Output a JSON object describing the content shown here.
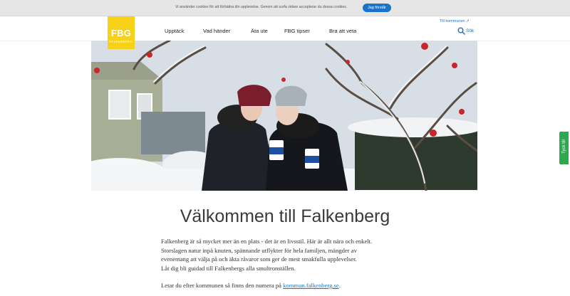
{
  "cookie": {
    "text": "Vi använder cookies för att förbättra din upplevelse. Genom att surfa vidare accepterar du dessa cookies.",
    "accept_label": "Jag förstår"
  },
  "header": {
    "logo_text": "FBG",
    "logo_subtext": "FALKENBERG",
    "top_link": "Till kommunen ↗",
    "search_label": "Sök",
    "nav": [
      "Upptäck",
      "Vad händer",
      "Äta ute",
      "FBG tipser",
      "Bra att veta"
    ]
  },
  "main": {
    "title": "Välkommen till Falkenberg",
    "intro_lines": [
      "Falkenberg är så mycket mer än en plats - det är en livsstil. Här är allt nära och enkelt.",
      "Storslagen natur inpå knuten, spännande utflykter för hela familjen, mängder av",
      "evenemang att välja på och äkta råvaror som ger de mest smakfulla upplevelser.",
      "Låt dig bli guidad till Falkenbergs alla smultronställen."
    ],
    "kommun_prefix": "Letar du efter kommunen så finns den numera på",
    "kommun_link": "kommun.falkenberg.se",
    "kommun_suffix": "."
  },
  "feedback_label": "Tyck till",
  "colors": {
    "brand_yellow": "#f7d117",
    "link_blue": "#1a73c9",
    "feedback_green": "#2fa84f"
  }
}
